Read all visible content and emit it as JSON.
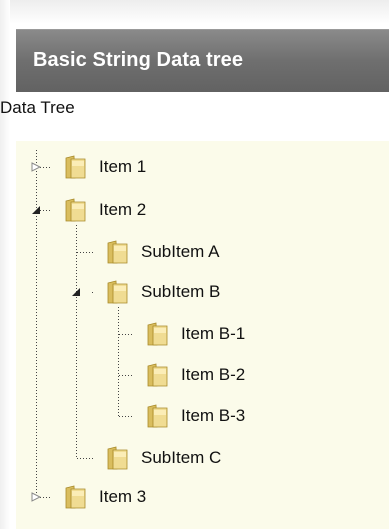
{
  "window": {
    "title": "Basic String Data tree"
  },
  "tree": {
    "label": "Data Tree",
    "nodes": [
      {
        "label": "Item 1",
        "state": "collapsed"
      },
      {
        "label": "Item 2",
        "state": "expanded"
      },
      {
        "label": "SubItem A",
        "state": "leaf"
      },
      {
        "label": "SubItem B",
        "state": "expanded"
      },
      {
        "label": "Item B-1",
        "state": "leaf"
      },
      {
        "label": "Item B-2",
        "state": "leaf"
      },
      {
        "label": "Item B-3",
        "state": "leaf"
      },
      {
        "label": "SubItem C",
        "state": "leaf"
      },
      {
        "label": "Item 3",
        "state": "collapsed"
      }
    ]
  },
  "colors": {
    "titlebar": "#707070",
    "tree_background": "#fbfbea",
    "folder": "#e0c97a"
  },
  "icons": {
    "folder": "folder-icon",
    "expanded": "expanded-triangle-icon",
    "collapsed": "collapsed-triangle-icon"
  }
}
